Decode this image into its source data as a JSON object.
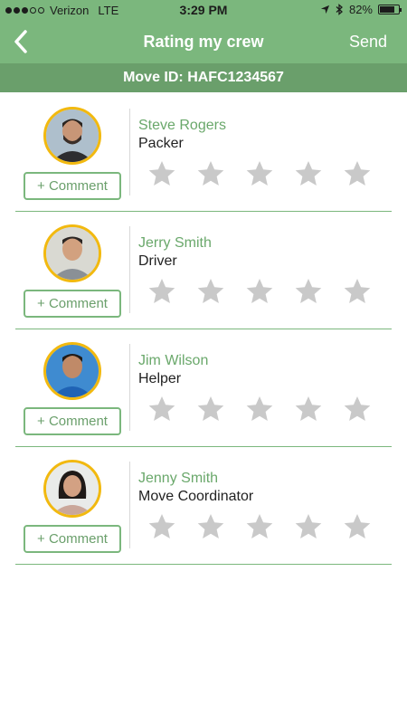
{
  "status": {
    "carrier": "Verizon",
    "network": "LTE",
    "time": "3:29 PM",
    "battery": "82%",
    "battery_level": 0.82
  },
  "nav": {
    "title": "Rating my crew",
    "send_label": "Send"
  },
  "move_id": "Move ID: HAFC1234567",
  "colors": {
    "header": "#7bb77d",
    "subheader": "#6a9f6b",
    "avatar_ring": "#f2b90f",
    "star": "#c9c9c9",
    "accent_text": "#6aa86b"
  },
  "crew": [
    {
      "name": "Steve Rogers",
      "role": "Packer",
      "comment_label": "+ Comment",
      "rating": 0
    },
    {
      "name": "Jerry Smith",
      "role": "Driver",
      "comment_label": "+ Comment",
      "rating": 0
    },
    {
      "name": "Jim Wilson",
      "role": "Helper",
      "comment_label": "+ Comment",
      "rating": 0
    },
    {
      "name": "Jenny Smith",
      "role": "Move Coordinator",
      "comment_label": "+ Comment",
      "rating": 0
    }
  ]
}
